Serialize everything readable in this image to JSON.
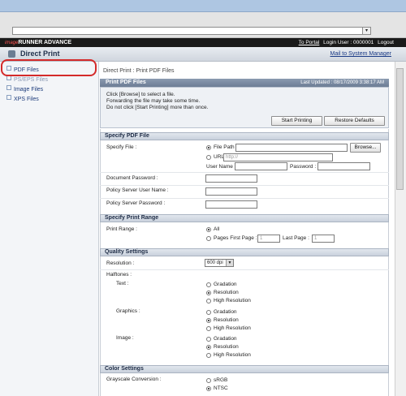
{
  "header": {
    "brand_prefix": "image",
    "brand_name": "RUNNER ADVANCE",
    "to_portal": "To Portal",
    "login_user": "Login User : 0000001",
    "logout": "Logout",
    "app_title": "Direct Print",
    "mail_link": "Mail to System Manager"
  },
  "sidebar": {
    "items": [
      {
        "label": "PDF Files"
      },
      {
        "label": "PS/EPS Files"
      },
      {
        "label": "Image Files"
      },
      {
        "label": "XPS Files"
      }
    ]
  },
  "main": {
    "breadcrumb": "Direct Print : Print PDF Files",
    "panel_title": "Print PDF Files",
    "last_updated": "Last Updated : 08/17/2009 3:38:17 AM",
    "instructions": [
      "Click [Browse] to select a file.",
      "Forwarding the file may take some time.",
      "Do not click [Start Printing] more than once."
    ],
    "start_printing": "Start Printing",
    "restore_defaults": "Restore Defaults",
    "specify_pdf_file": {
      "title": "Specify PDF File",
      "specify_file_label": "Specify File :",
      "file_path_label": "File Path",
      "browse": "Browse...",
      "url_label": "URL",
      "url_placeholder": "http://",
      "user_name_label": "User Name :",
      "password_label": "Password :",
      "document_password": "Document Password :",
      "policy_user": "Policy Server User Name :",
      "policy_password": "Policy Server Password :"
    },
    "print_range": {
      "title": "Specify Print Range",
      "label": "Print Range :",
      "all": "All",
      "pages": "Pages First Page :",
      "first_value": "1",
      "last_label": "Last Page :",
      "last_value": "1"
    },
    "quality": {
      "title": "Quality Settings",
      "resolution_label": "Resolution :",
      "resolution_value": "600 dpi",
      "halftones_label": "Halftones :",
      "groups": [
        {
          "label": "Text :",
          "options": [
            "Gradation",
            "Resolution",
            "High Resolution"
          ],
          "selected": "Resolution"
        },
        {
          "label": "Graphics :",
          "options": [
            "Gradation",
            "Resolution",
            "High Resolution"
          ],
          "selected": "Resolution"
        },
        {
          "label": "Image :",
          "options": [
            "Gradation",
            "Resolution",
            "High Resolution"
          ],
          "selected": "Resolution"
        }
      ]
    },
    "color": {
      "title": "Color Settings",
      "grayscale_label": "Grayscale Conversion :",
      "options": [
        "sRGB",
        "NTSC"
      ],
      "selected": "NTSC"
    }
  },
  "colors": {
    "highlight": "#d42a2a",
    "header_bg": "#1a1a1a",
    "panel_title_bg": "#6c7d95",
    "link": "#1a3a86"
  }
}
